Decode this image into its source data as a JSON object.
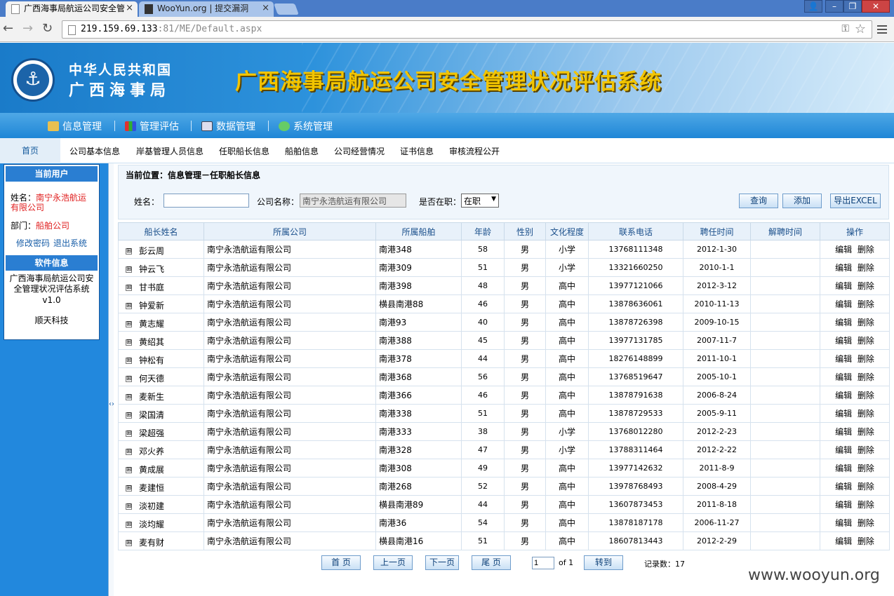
{
  "browser": {
    "tabs": [
      {
        "title": "广西海事局航运公司安全管",
        "close": "×"
      },
      {
        "title": "WooYun.org | 提交漏洞",
        "close": "×"
      }
    ],
    "url_host": "219.159.69.133",
    "url_port": ":81",
    "url_path": "/ME/Default.aspx"
  },
  "header": {
    "org_line1": "中华人民共和国",
    "org_line2": "广西海事局",
    "system_title": "广西海事局航运公司安全管理状况评估系统"
  },
  "main_nav": [
    "信息管理",
    "管理评估",
    "数据管理",
    "系统管理"
  ],
  "sub_nav": {
    "home": "首页",
    "items": [
      "公司基本信息",
      "岸基管理人员信息",
      "任职船长信息",
      "船舶信息",
      "公司经营情况",
      "证书信息",
      "审核流程公开"
    ]
  },
  "sidebar": {
    "current_user_title": "当前用户",
    "name_label": "姓名：",
    "name_value": "南宁永浩航运有限公司",
    "dept_label": "部门：",
    "dept_value": "船舶公司",
    "change_password": "修改密码",
    "logout": "退出系统",
    "software_title": "软件信息",
    "software_name": "广西海事局航运公司安全管理状况评估系统",
    "version": "v1.0",
    "vendor": "顺天科技"
  },
  "search": {
    "breadcrumb": "当前位置：信息管理－任职船长信息",
    "name_label": "姓名：",
    "name_value": "",
    "company_label": "公司名称：",
    "company_value": "南宁永浩航运有限公司",
    "employed_label": "是否在职：",
    "employed_value": "在职",
    "query_button": "查询",
    "add_button": "添加",
    "export_button": "导出EXCEL"
  },
  "table": {
    "headers": [
      "船长姓名",
      "所属公司",
      "所属船舶",
      "年龄",
      "性别",
      "文化程度",
      "联系电话",
      "聘任时间",
      "解聘时间",
      "操作"
    ],
    "edit_label": "编辑",
    "delete_label": "删除",
    "rows": [
      [
        "彭云周",
        "南宁永浩航运有限公司",
        "南港348",
        "58",
        "男",
        "小学",
        "13768111348",
        "2012-1-30",
        ""
      ],
      [
        "钟云飞",
        "南宁永浩航运有限公司",
        "南港309",
        "51",
        "男",
        "小学",
        "13321660250",
        "2010-1-1",
        ""
      ],
      [
        "甘书庭",
        "南宁永浩航运有限公司",
        "南港398",
        "48",
        "男",
        "高中",
        "13977121066",
        "2012-3-12",
        ""
      ],
      [
        "钟爱新",
        "南宁永浩航运有限公司",
        "横县南港88",
        "46",
        "男",
        "高中",
        "13878636061",
        "2010-11-13",
        ""
      ],
      [
        "黄志耀",
        "南宁永浩航运有限公司",
        "南港93",
        "40",
        "男",
        "高中",
        "13878726398",
        "2009-10-15",
        ""
      ],
      [
        "黄绍其",
        "南宁永浩航运有限公司",
        "南港388",
        "45",
        "男",
        "高中",
        "13977131785",
        "2007-11-7",
        ""
      ],
      [
        "钟松有",
        "南宁永浩航运有限公司",
        "南港378",
        "44",
        "男",
        "高中",
        "18276148899",
        "2011-10-1",
        ""
      ],
      [
        "何天德",
        "南宁永浩航运有限公司",
        "南港368",
        "56",
        "男",
        "高中",
        "13768519647",
        "2005-10-1",
        ""
      ],
      [
        "麦新生",
        "南宁永浩航运有限公司",
        "南港366",
        "46",
        "男",
        "高中",
        "13878791638",
        "2006-8-24",
        ""
      ],
      [
        "梁国清",
        "南宁永浩航运有限公司",
        "南港338",
        "51",
        "男",
        "高中",
        "13878729533",
        "2005-9-11",
        ""
      ],
      [
        "梁超强",
        "南宁永浩航运有限公司",
        "南港333",
        "38",
        "男",
        "小学",
        "13768012280",
        "2012-2-23",
        ""
      ],
      [
        "邓火养",
        "南宁永浩航运有限公司",
        "南港328",
        "47",
        "男",
        "小学",
        "13788311464",
        "2012-2-22",
        ""
      ],
      [
        "黄成展",
        "南宁永浩航运有限公司",
        "南港308",
        "49",
        "男",
        "高中",
        "13977142632",
        "2011-8-9",
        ""
      ],
      [
        "麦建恒",
        "南宁永浩航运有限公司",
        "南港268",
        "52",
        "男",
        "高中",
        "13978768493",
        "2008-4-29",
        ""
      ],
      [
        "淡初建",
        "南宁永浩航运有限公司",
        "横县南港89",
        "44",
        "男",
        "高中",
        "13607873453",
        "2011-8-18",
        ""
      ],
      [
        "淡均耀",
        "南宁永浩航运有限公司",
        "南港36",
        "54",
        "男",
        "高中",
        "13878187178",
        "2006-11-27",
        ""
      ],
      [
        "麦有财",
        "南宁永浩航运有限公司",
        "横县南港16",
        "51",
        "男",
        "高中",
        "18607813443",
        "2012-2-29",
        ""
      ]
    ]
  },
  "pager": {
    "first": "首 页",
    "prev": "上一页",
    "next": "下一页",
    "last": "尾 页",
    "page_value": "1",
    "of_text": "of 1",
    "go": "转到",
    "record_label": "记录数：",
    "record_count": "17"
  },
  "watermark": "www.wooyun.org",
  "icons": {
    "expand": "⊞",
    "main_nav": [
      "edit-pen-icon",
      "chart-bars-icon",
      "database-grid-icon",
      "system-gear-icon"
    ]
  },
  "colors": {
    "accent": "#2288dd",
    "title_gold": "#f2c400",
    "highlight_red": "#e02020"
  }
}
